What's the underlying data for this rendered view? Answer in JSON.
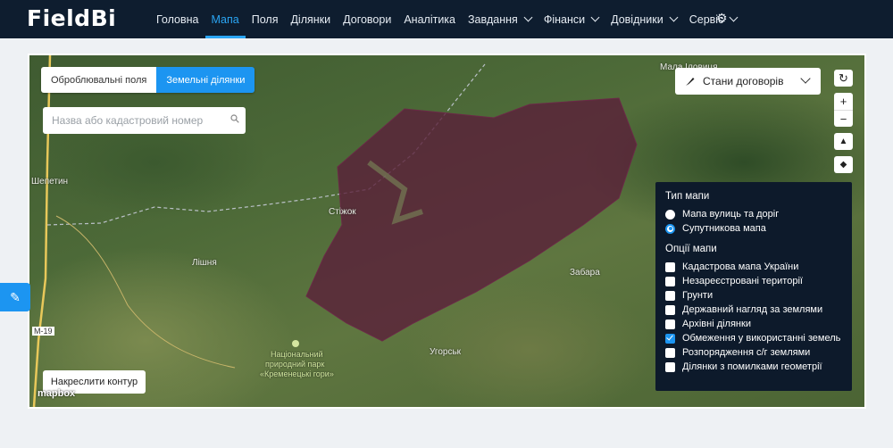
{
  "app": {
    "logo_text": "FieldBi"
  },
  "nav": {
    "items": [
      {
        "label": "Головна"
      },
      {
        "label": "Мапа"
      },
      {
        "label": "Поля"
      },
      {
        "label": "Ділянки"
      },
      {
        "label": "Договори"
      },
      {
        "label": "Аналітика"
      },
      {
        "label": "Завдання"
      },
      {
        "label": "Фінанси"
      },
      {
        "label": "Довідники"
      },
      {
        "label": "Сервіс"
      }
    ],
    "active": "Мапа"
  },
  "map": {
    "tabs": {
      "fields": "Оброблювальні поля",
      "plots": "Земельні ділянки"
    },
    "search": {
      "placeholder": "Назва або кадастровий номер"
    },
    "contracts_button": "Стани договорів",
    "draw_button": "Накреслити контур",
    "attribution": "mapbox",
    "places": {
      "shepetyn": "Шепетин",
      "stizhok": "Стіжок",
      "lishnia": "Лішня",
      "zabara": "Забара",
      "uhorsk": "Угорськ",
      "mala": "Мала Іловиця",
      "road": "М-19",
      "park_line1": "Національний",
      "park_line2": "природний парк",
      "park_line3": "«Кременецькі гори»"
    },
    "controls": {
      "zoom_in": "+",
      "zoom_out": "−"
    }
  },
  "layers_panel": {
    "map_type_title": "Тип мапи",
    "map_types": [
      {
        "label": "Мапа вулиць та доріг",
        "selected": false
      },
      {
        "label": "Супутникова мапа",
        "selected": true
      }
    ],
    "options_title": "Опції мапи",
    "options": [
      {
        "label": "Кадастрова мапа України",
        "checked": false
      },
      {
        "label": "Незареєстровані території",
        "checked": false
      },
      {
        "label": "Грунти",
        "checked": false
      },
      {
        "label": "Державний нагляд за землями",
        "checked": false
      },
      {
        "label": "Архівні ділянки",
        "checked": false
      },
      {
        "label": "Обмеження у використанні земель",
        "checked": true
      },
      {
        "label": "Розпорядження с/г землями",
        "checked": false
      },
      {
        "label": "Ділянки з помилками геометрії",
        "checked": false
      }
    ]
  },
  "colors": {
    "accent": "#1c95f1",
    "topbar": "#0e1d2f",
    "overlay": "#5a1f3a"
  }
}
